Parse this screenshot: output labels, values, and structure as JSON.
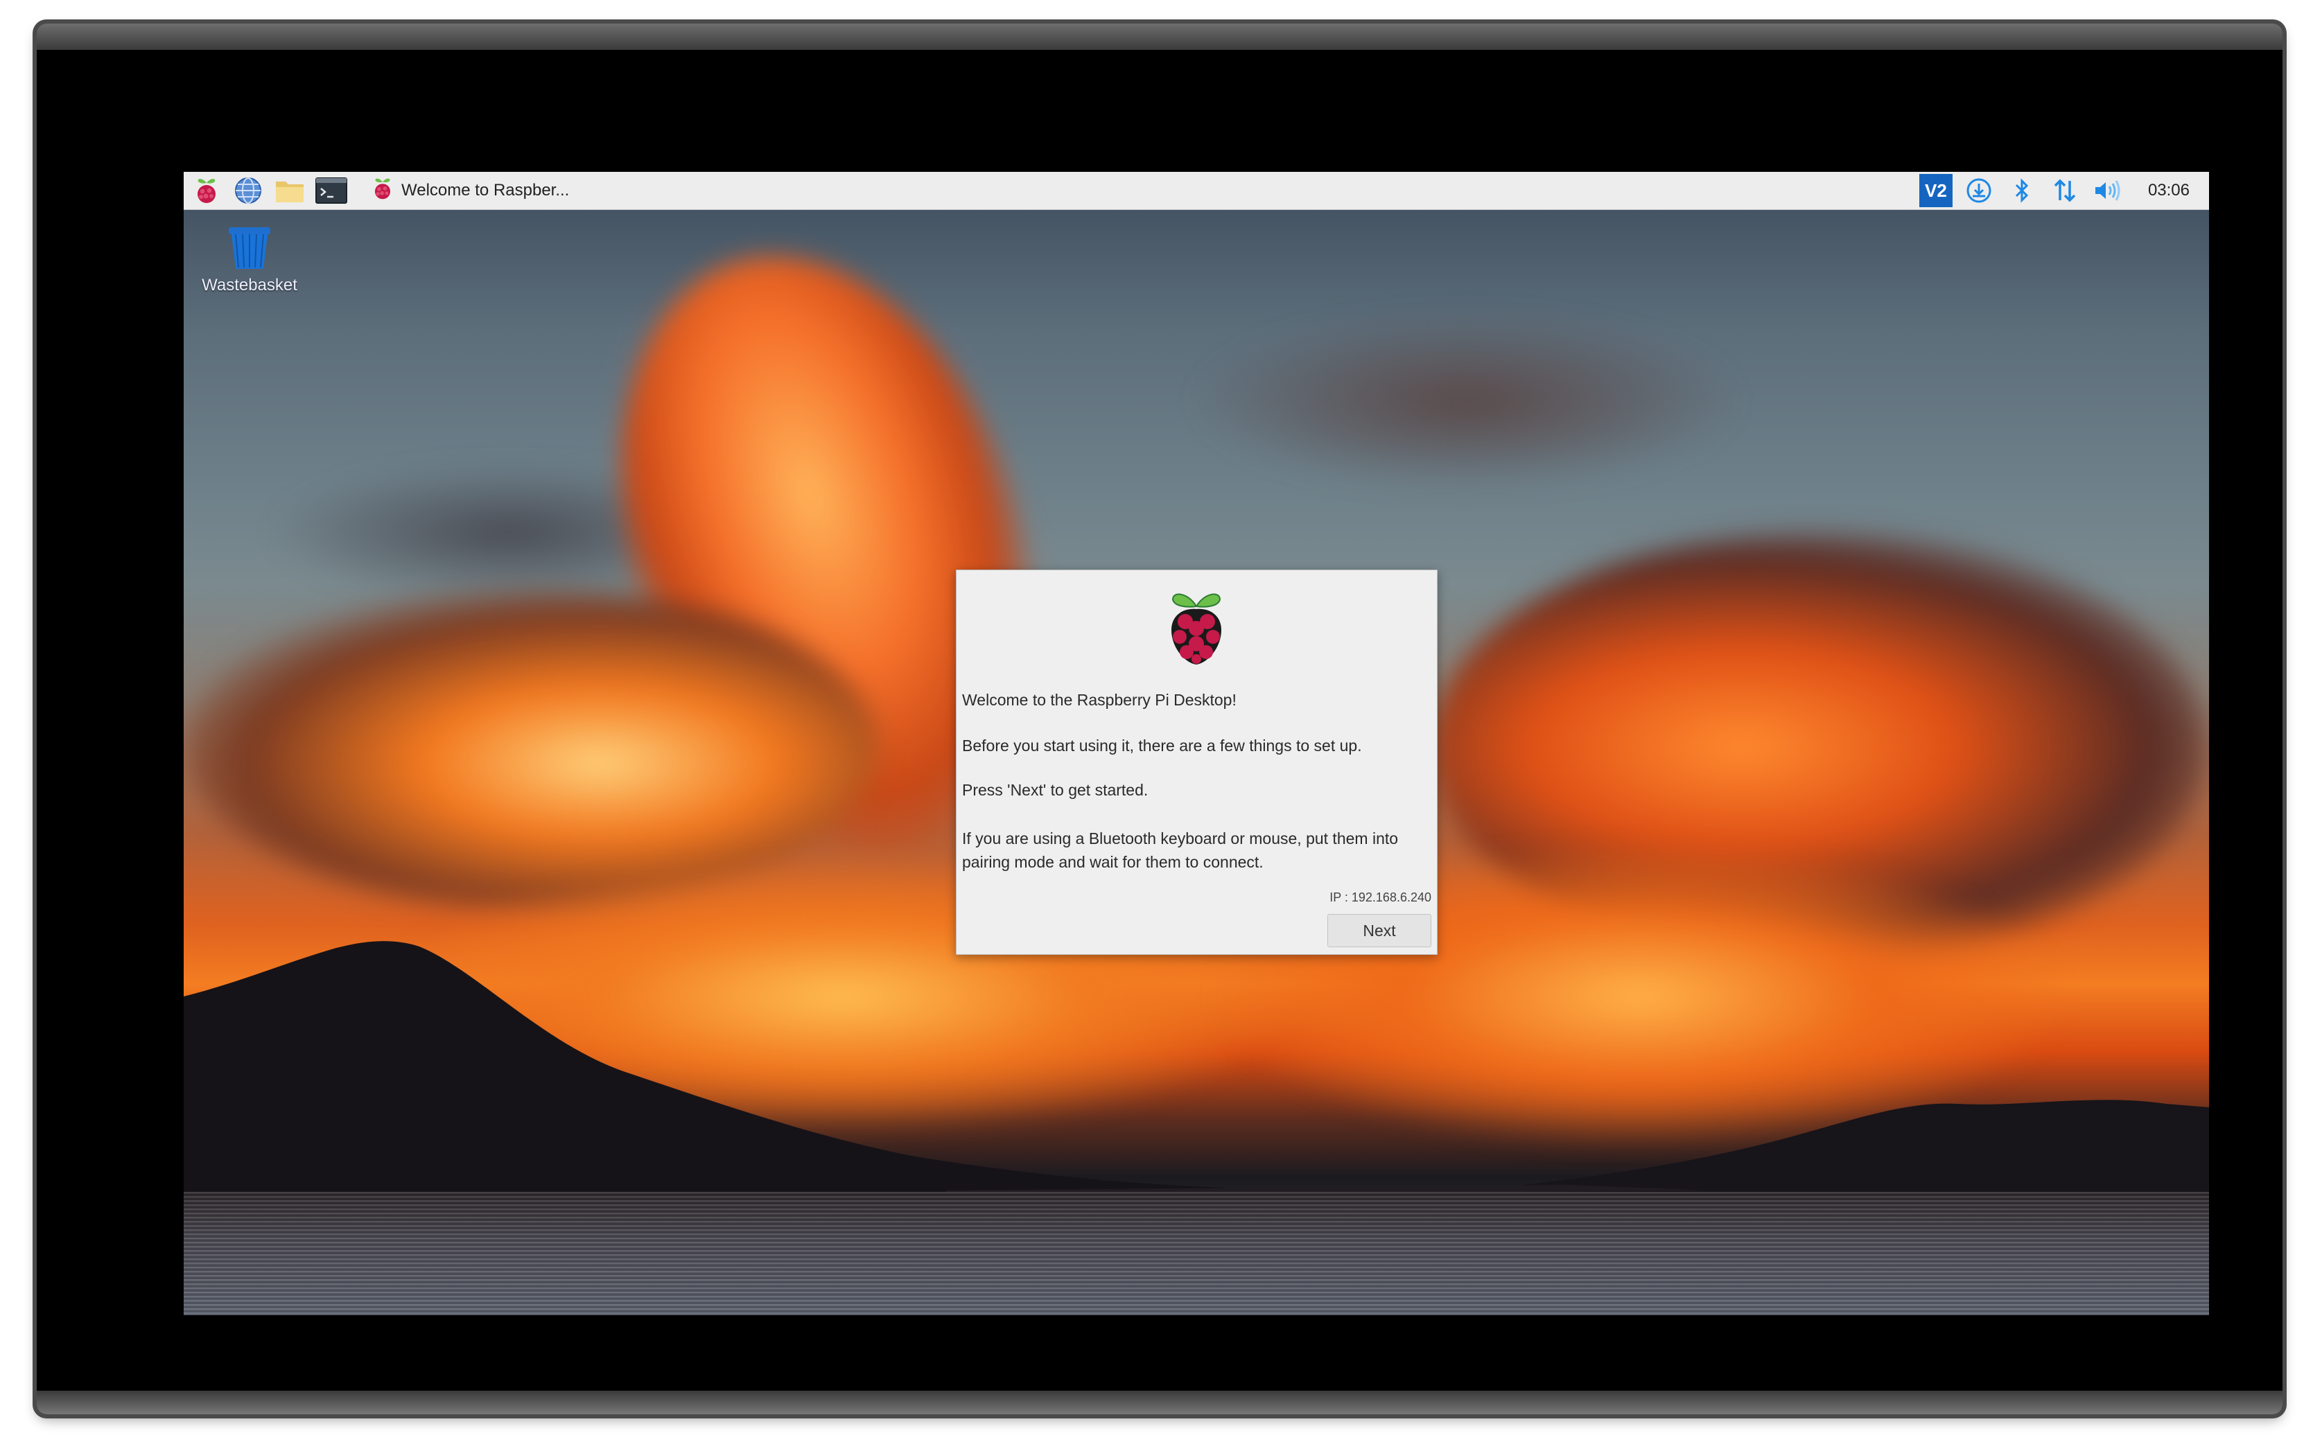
{
  "taskbar": {
    "launchers": [
      {
        "icon": "raspberry-menu-icon"
      },
      {
        "icon": "web-browser-icon"
      },
      {
        "icon": "file-manager-icon"
      },
      {
        "icon": "terminal-icon"
      }
    ],
    "window_title": "Welcome to Raspber...",
    "tray": {
      "vnc_label": "V2",
      "icons": [
        "vnc-icon",
        "update-icon",
        "bluetooth-icon",
        "network-icon",
        "volume-icon"
      ],
      "clock": "03:06"
    }
  },
  "desktop": {
    "icons": [
      {
        "label": "Wastebasket",
        "icon": "wastebasket-icon"
      }
    ]
  },
  "dialog": {
    "line1": "Welcome to the Raspberry Pi Desktop!",
    "line2": "Before you start using it, there are a few things to set up.",
    "line3": "Press 'Next' to get started.",
    "line4": "If you are using a Bluetooth keyboard or mouse, put them into pairing mode and wait for them to connect.",
    "ip": "IP : 192.168.6.240",
    "next_label": "Next"
  },
  "colors": {
    "taskbar_bg": "#ededed",
    "tray_accent": "#1e88e5",
    "dialog_bg": "#efefef",
    "raspberry_red": "#c51a4a",
    "leaf_green": "#6cc04a"
  }
}
